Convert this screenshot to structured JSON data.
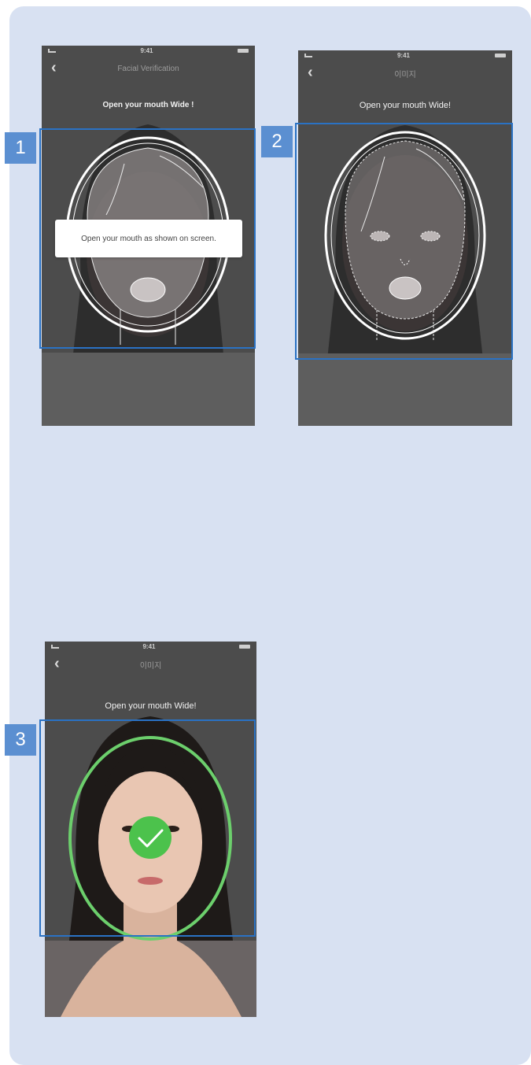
{
  "steps": [
    {
      "badge": "1",
      "status_time": "9:41",
      "nav_title": "Facial Verification",
      "instruction": "Open your mouth Wide !",
      "popup": "Open your mouth as shown on screen."
    },
    {
      "badge": "2",
      "status_time": "9:41",
      "nav_title": "이미지",
      "instruction": "Open your mouth Wide!"
    },
    {
      "badge": "3",
      "status_time": "9:41",
      "nav_title": "이미지",
      "instruction": "Open your mouth Wide!"
    }
  ],
  "icons": {
    "back": "chevron-left-icon",
    "success": "checkmark-icon"
  },
  "colors": {
    "card_background": "#d8e1f2",
    "highlight_border": "#2a72c4",
    "badge": "#5b8fd1",
    "guide_outline": "#ffffff",
    "success_green": "#4cc24c",
    "oval_success": "#6ccf6c"
  }
}
